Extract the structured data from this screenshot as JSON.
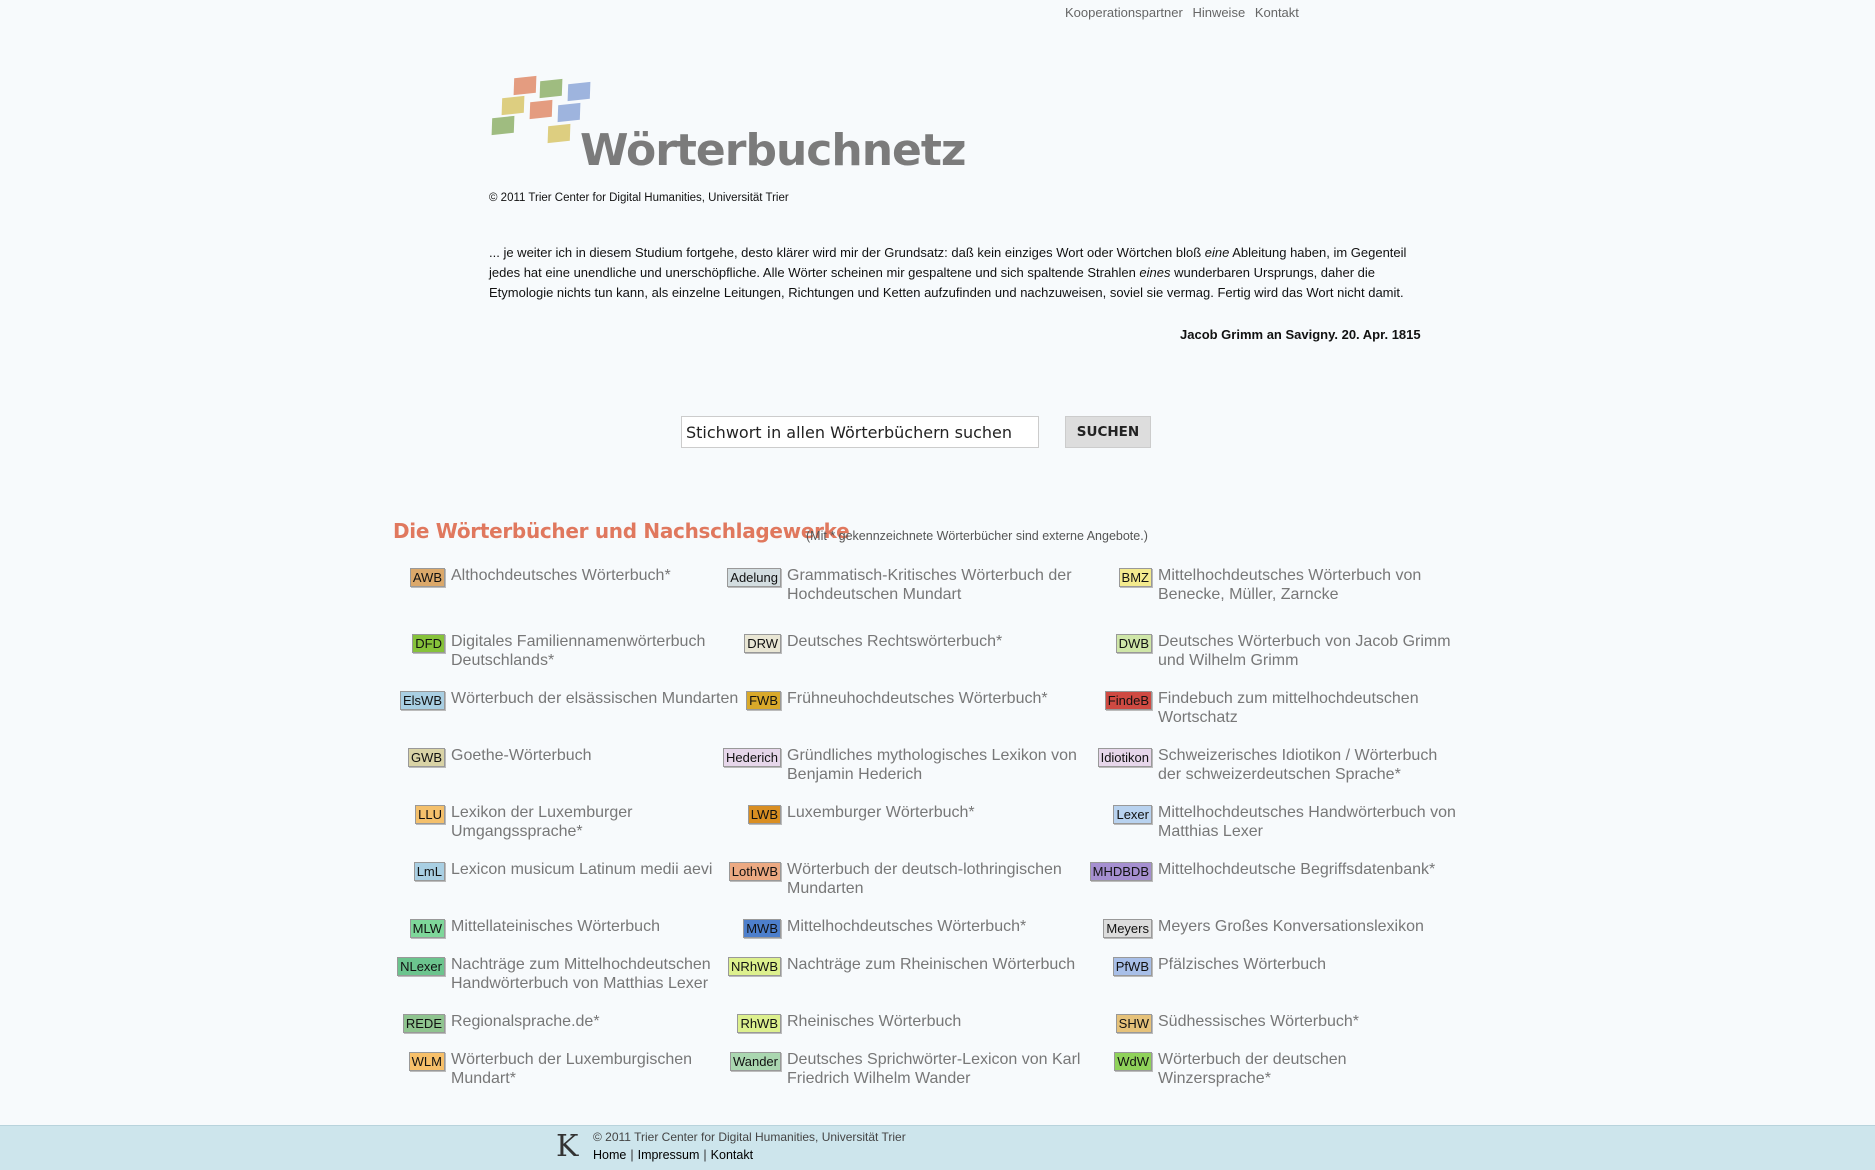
{
  "topnav": {
    "partner": "Kooperationspartner",
    "hints": "Hinweise",
    "contact": "Kontakt"
  },
  "logo": {
    "wordmark": "Wörterbuchnetz",
    "tile_colors": [
      "#e08b6a",
      "#8fb06a",
      "#8ea7d8",
      "#d8c66a",
      "#e08b6a",
      "#8ea7d8",
      "#8fb06a",
      "#d8c66a"
    ]
  },
  "copyright": "© 2011 Trier Center for Digital Humanities, Universität Trier",
  "quote": {
    "p1": "... je weiter ich in diesem Studium fortgehe, desto klärer wird mir der Grundsatz: daß kein einziges Wort oder Wörtchen bloß ",
    "em1": "eine",
    "p2": " Ableitung haben, im Gegenteil jedes hat eine unendliche und unerschöpfliche. Alle Wörter scheinen mir gespaltene und sich spaltende Strahlen ",
    "em2": "eines",
    "p3": " wunderbaren Ursprungs, daher die Etymologie nichts tun kann, als einzelne Leitungen, Richtungen und Ketten aufzufinden und nachzuweisen, soviel sie vermag. Fertig wird das Wort nicht damit.",
    "source": "Jacob Grimm an Savigny. 20. Apr. 1815"
  },
  "search": {
    "value": "Stichwort in allen Wörterbüchern suchen",
    "button": "SUCHEN"
  },
  "section": {
    "title": "Die Wörterbücher und Nachschlagewerke",
    "note": "(Mit * gekennzeichnete Wörterbücher sind externe Angebote.)"
  },
  "dictionaries": [
    {
      "abbr": "AWB",
      "name": "Althochdeutsches Wörterbuch*",
      "color": "#dba86a"
    },
    {
      "abbr": "Adelung",
      "name": "Grammatisch-Kritisches Wörterbuch der Hochdeutschen Mundart",
      "color": "#d3dde0"
    },
    {
      "abbr": "BMZ",
      "name": "Mittelhochdeutsches Wörterbuch von Benecke, Müller, Zarncke",
      "color": "#f3ea8e"
    },
    {
      "abbr": "DFD",
      "name": "Digitales Familiennamenwörterbuch Deutschlands*",
      "color": "#86c23a"
    },
    {
      "abbr": "DRW",
      "name": "Deutsches Rechtswörterbuch*",
      "color": "#e9e6d4"
    },
    {
      "abbr": "DWB",
      "name": "Deutsches Wörterbuch von Jacob Grimm und Wilhelm Grimm",
      "color": "#cfe6a8"
    },
    {
      "abbr": "ElsWB",
      "name": "Wörterbuch der elsässischen Mundarten",
      "color": "#a9cfe3"
    },
    {
      "abbr": "FWB",
      "name": "Frühneuhochdeutsches Wörterbuch*",
      "color": "#d9a92a"
    },
    {
      "abbr": "FindeB",
      "name": "Findebuch zum mittelhochdeutschen Wortschatz",
      "color": "#cf4a42"
    },
    {
      "abbr": "GWB",
      "name": "Goethe-Wörterbuch",
      "color": "#d9d3a6"
    },
    {
      "abbr": "Hederich",
      "name": "Gründliches mythologisches Lexikon von Benjamin Hederich",
      "color": "#e6d6ea"
    },
    {
      "abbr": "Idiotikon",
      "name": "Schweizerisches Idiotikon / Wörterbuch der schweizerdeutschen Sprache*",
      "color": "#e6d6ea"
    },
    {
      "abbr": "LLU",
      "name": "Lexikon der Luxemburger Umgangssprache*",
      "color": "#f4c06c"
    },
    {
      "abbr": "LWB",
      "name": "Luxemburger Wörterbuch*",
      "color": "#d98e22"
    },
    {
      "abbr": "Lexer",
      "name": "Mittelhochdeutsches Handwörterbuch von Matthias Lexer",
      "color": "#b8d2ef"
    },
    {
      "abbr": "LmL",
      "name": "Lexicon musicum Latinum medii aevi",
      "color": "#a9cfe3"
    },
    {
      "abbr": "LothWB",
      "name": "Wörterbuch der deutsch-lothringischen Mundarten",
      "color": "#eca982"
    },
    {
      "abbr": "MHDBDB",
      "name": "Mittelhochdeutsche Begriffsdatenbank*",
      "color": "#a58fd0"
    },
    {
      "abbr": "MLW",
      "name": "Mittellateinisches Wörterbuch",
      "color": "#7ed79a"
    },
    {
      "abbr": "MWB",
      "name": "Mittelhochdeutsches Wörterbuch*",
      "color": "#4d7fcc"
    },
    {
      "abbr": "Meyers",
      "name": "Meyers Großes Konversationslexikon",
      "color": "#dcdcdc"
    },
    {
      "abbr": "NLexer",
      "name": "Nachträge zum Mittelhochdeutschen Handwörterbuch von Matthias Lexer",
      "color": "#6cc48e"
    },
    {
      "abbr": "NRhWB",
      "name": "Nachträge zum Rheinischen Wörterbuch",
      "color": "#ddf08e"
    },
    {
      "abbr": "PfWB",
      "name": "Pfälzisches Wörterbuch",
      "color": "#a8bfe8"
    },
    {
      "abbr": "REDE",
      "name": "Regionalsprache.de*",
      "color": "#8fc48f"
    },
    {
      "abbr": "RhWB",
      "name": "Rheinisches Wörterbuch",
      "color": "#ddf08e"
    },
    {
      "abbr": "SHW",
      "name": "Südhessisches Wörterbuch*",
      "color": "#e6c27a"
    },
    {
      "abbr": "WLM",
      "name": "Wörterbuch der Luxemburgischen Mundart*",
      "color": "#f7c06a"
    },
    {
      "abbr": "Wander",
      "name": "Deutsches Sprichwörter-Lexicon von Karl Friedrich Wilhelm Wander",
      "color": "#aad7b0"
    },
    {
      "abbr": "WdW",
      "name": "Wörterbuch der deutschen Winzersprache*",
      "color": "#8fd25a"
    }
  ],
  "footer": {
    "icon": "K",
    "copyright": "© 2011 Trier Center for Digital Humanities, Universität Trier",
    "home": "Home",
    "impressum": "Impressum",
    "contact": "Kontakt"
  }
}
